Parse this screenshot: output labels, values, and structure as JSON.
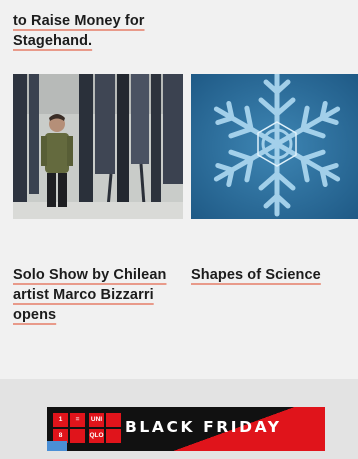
{
  "articles": {
    "top": {
      "title": "to Raise Money for Stagehand."
    },
    "left": {
      "title": "Solo Show by Chilean artist Marco Bizzarri opens",
      "image": "artist-in-studio-photo"
    },
    "right": {
      "title": "Shapes of Science",
      "image": "snowflake-photo"
    }
  },
  "ad": {
    "logo": [
      "1",
      "=",
      "8",
      "UNI",
      "QLO"
    ],
    "text": "BLACK FRIDAY",
    "colors": {
      "red": "#e0141b",
      "black": "#111111"
    }
  },
  "colors": {
    "underline": "#e89a8a",
    "background": "#f1f1f1"
  }
}
